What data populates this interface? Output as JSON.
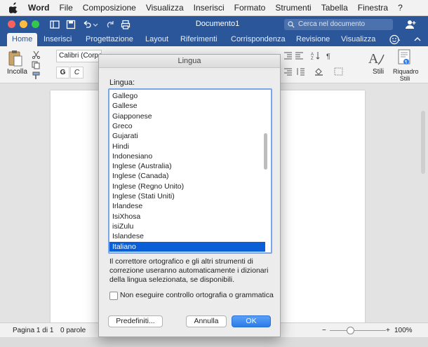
{
  "menubar": {
    "app": "Word",
    "items": [
      "File",
      "Composizione",
      "Visualizza",
      "Inserisci",
      "Formato",
      "Strumenti",
      "Tabella",
      "Finestra",
      "?"
    ]
  },
  "window": {
    "title": "Documento1",
    "search_placeholder": "Cerca nel documento"
  },
  "ribbon_tabs": [
    "Home",
    "Inserisci",
    "Progettazione",
    "Layout",
    "Riferimenti",
    "Corrispondenza",
    "Revisione",
    "Visualizza"
  ],
  "ribbon": {
    "paste_label": "Incolla",
    "font_name": "Calibri (Corpo)",
    "bold": "G",
    "italic": "C",
    "styles_label": "Stili",
    "styles_pane_label": "Riquadro Stili"
  },
  "dialog": {
    "title": "Lingua",
    "list_label": "Lingua:",
    "languages": [
      "Gallego",
      "Gallese",
      "Giapponese",
      "Greco",
      "Gujarati",
      "Hindi",
      "Indonesiano",
      "Inglese (Australia)",
      "Inglese (Canada)",
      "Inglese (Regno Unito)",
      "Inglese (Stati Uniti)",
      "Irlandese",
      "IsiXhosa",
      "isiZulu",
      "Islandese",
      "Italiano"
    ],
    "selected_language": "Italiano",
    "description": "Il correttore ortografico e gli altri strumenti di correzione useranno automaticamente i dizionari della lingua selezionata, se disponibili.",
    "no_spellcheck_label": "Non eseguire controllo ortografia o grammatica",
    "no_spellcheck_checked": false,
    "default_button": "Predefiniti...",
    "cancel_button": "Annulla",
    "ok_button": "OK"
  },
  "statusbar": {
    "page": "Pagina 1 di 1",
    "words": "0 parole",
    "zoom_minus": "−",
    "zoom_plus": "+",
    "zoom": "100%"
  },
  "colors": {
    "word_blue": "#2b579a",
    "selection_blue": "#0a5fd6",
    "ok_blue": "#2b7ce9"
  }
}
